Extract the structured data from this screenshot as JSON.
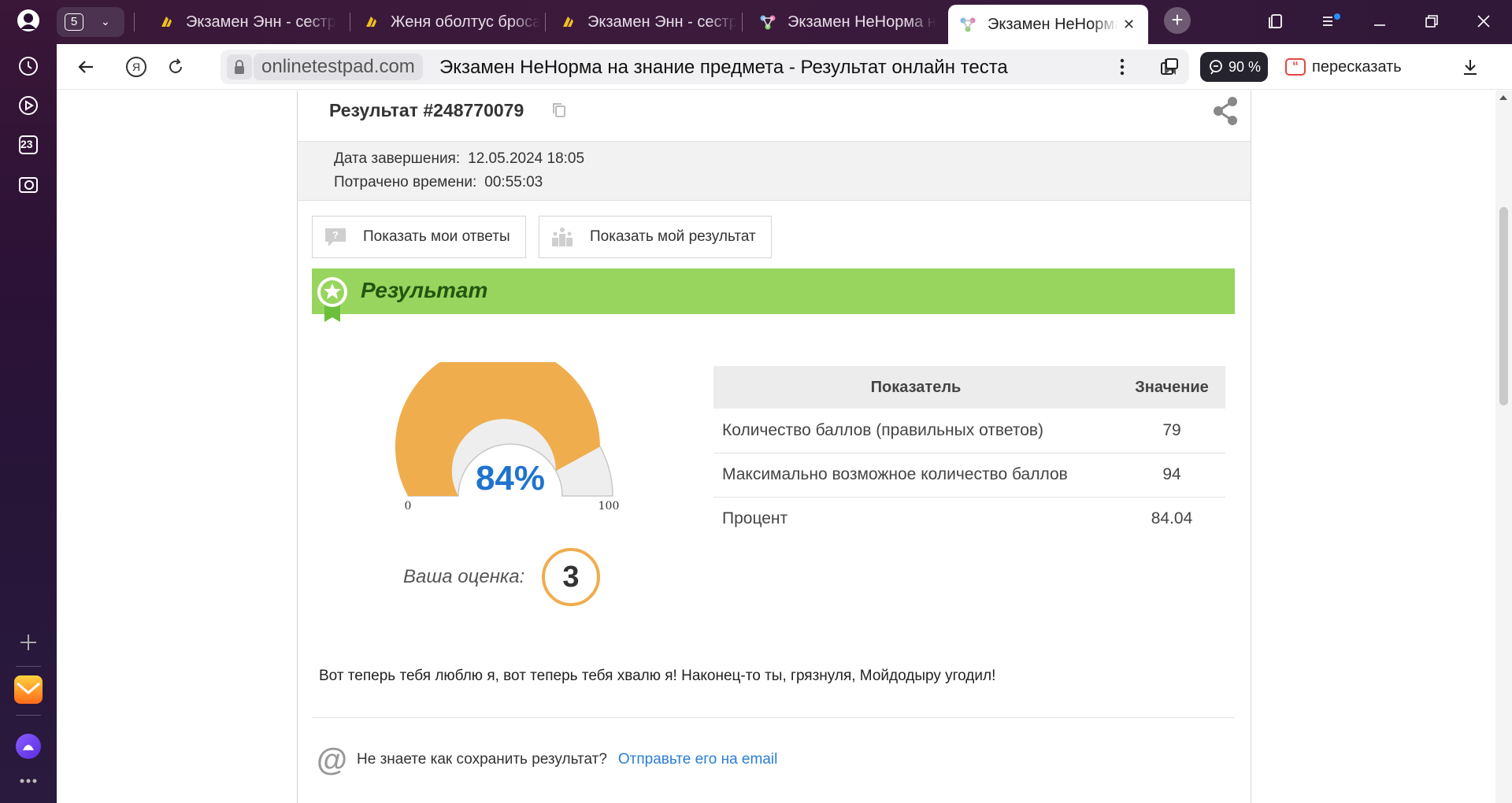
{
  "browser": {
    "tab_count": "5",
    "tabs": [
      {
        "title": "Экзамен Энн - сестр",
        "fav": "yellow"
      },
      {
        "title": "Женя оболтус бросa",
        "fav": "yellow"
      },
      {
        "title": "Экзамен Энн - сестр",
        "fav": "yellow"
      },
      {
        "title": "Экзамен НеНорма н",
        "fav": "molecule"
      },
      {
        "title": "Экзамен НеНорма",
        "fav": "molecule",
        "active": true
      }
    ],
    "calendar_day": "23",
    "address": {
      "domain": "onlinetestpad.com",
      "page_title": "Экзамен НеНорма на знание предмета - Результат онлайн теста"
    },
    "zoom": "90 %",
    "retell_label": "пересказать"
  },
  "result": {
    "heading": "Результат #248770079",
    "meta": [
      {
        "label": "Дата завершения:",
        "value": "12.05.2024 18:05"
      },
      {
        "label": "Потрачено времени:",
        "value": "00:55:03"
      }
    ],
    "buttons": {
      "show_answers": "Показать мои ответы",
      "show_result": "Показать мой результат"
    },
    "banner_title": "Результат",
    "gauge": {
      "value": 84,
      "label": "84%",
      "min_label": "0",
      "max_label": "100",
      "fill_color": "#efad4e",
      "rest_color": "#eeeeee",
      "text_color": "#1f73cf"
    },
    "grade_label": "Ваша оценка:",
    "grade": "3",
    "table": {
      "headers": [
        "Показатель",
        "Значение"
      ],
      "rows": [
        [
          "Количество баллов (правильных ответов)",
          "79"
        ],
        [
          "Максимально возможное количество баллов",
          "94"
        ],
        [
          "Процент",
          "84.04"
        ]
      ]
    },
    "message": "Вот теперь тебя люблю я, вот теперь тебя хвалю я! Наконец-то ты, грязнуля, Мойдодыру угодил!",
    "save": {
      "question": "Не знаете как сохранить результат?",
      "link": "Отправьте его на email"
    }
  }
}
